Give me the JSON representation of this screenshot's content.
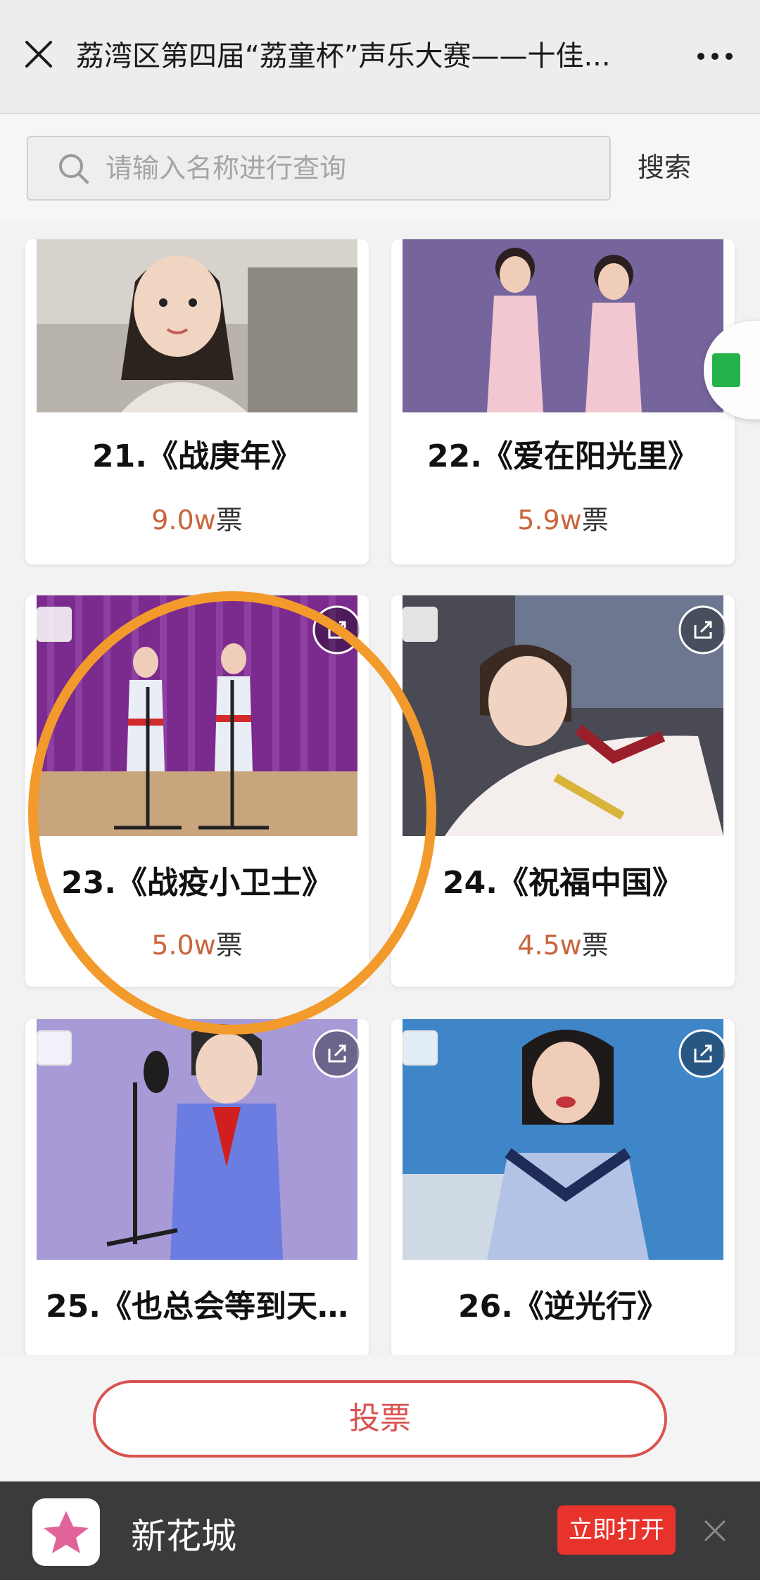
{
  "header": {
    "title": "荔湾区第四届“荔童杯”声乐大赛——十佳..."
  },
  "search": {
    "placeholder": "请输入名称进行查询",
    "button_label": "搜索"
  },
  "entries": [
    {
      "title": "21.《战庚年》",
      "votes_num": "9.0w",
      "votes_unit": "票"
    },
    {
      "title": "22.《爱在阳光里》",
      "votes_num": "5.9w",
      "votes_unit": "票"
    },
    {
      "title": "23.《战疫小卫士》",
      "votes_num": "5.0w",
      "votes_unit": "票"
    },
    {
      "title": "24.《祝福中国》",
      "votes_num": "4.5w",
      "votes_unit": "票"
    },
    {
      "title": "25.《也总会等到天…",
      "votes_num": "",
      "votes_unit": ""
    },
    {
      "title": "26.《逆光行》",
      "votes_num": "",
      "votes_unit": ""
    }
  ],
  "footer": {
    "vote_label": "投票"
  },
  "banner": {
    "app_name": "新花城",
    "open_label": "立即打开"
  },
  "colors": {
    "accent": "#d9534f",
    "votes": "#c8653c",
    "highlight_circle": "#f39a2c",
    "open_button": "#e8322c"
  }
}
